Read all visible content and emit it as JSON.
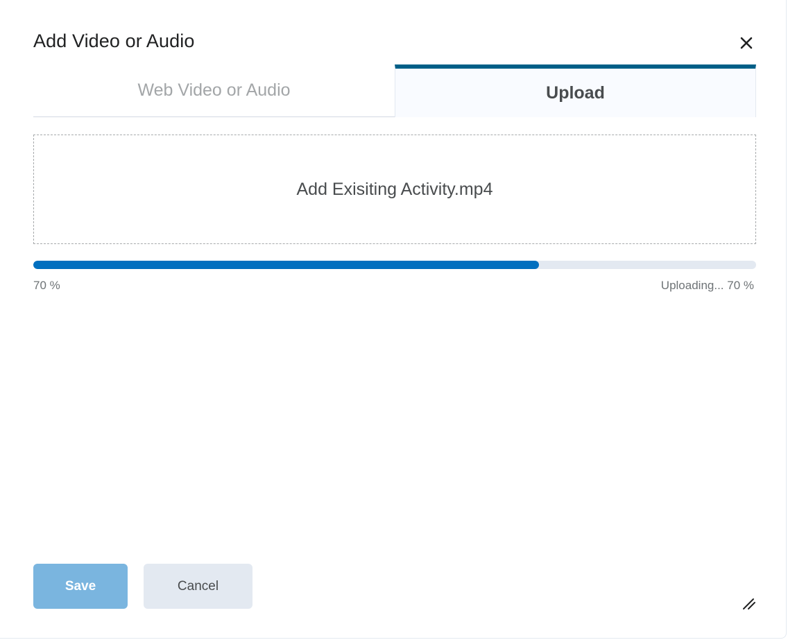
{
  "dialog": {
    "title": "Add Video or Audio"
  },
  "tabs": [
    {
      "label": "Web Video or Audio",
      "active": false
    },
    {
      "label": "Upload",
      "active": true
    }
  ],
  "dropzone": {
    "file_name": "Add Exisiting Activity.mp4"
  },
  "progress": {
    "percent": 70,
    "left_label": "70 %",
    "status_label": "Uploading... 70 %"
  },
  "footer": {
    "save_label": "Save",
    "cancel_label": "Cancel"
  },
  "colors": {
    "accent": "#006fbf",
    "tab_indicator": "#005f87",
    "save_disabled": "#7ab5df",
    "secondary_button": "#e3e9f1"
  },
  "icons": {
    "close": "close-icon",
    "resize": "resize-handle-icon"
  }
}
